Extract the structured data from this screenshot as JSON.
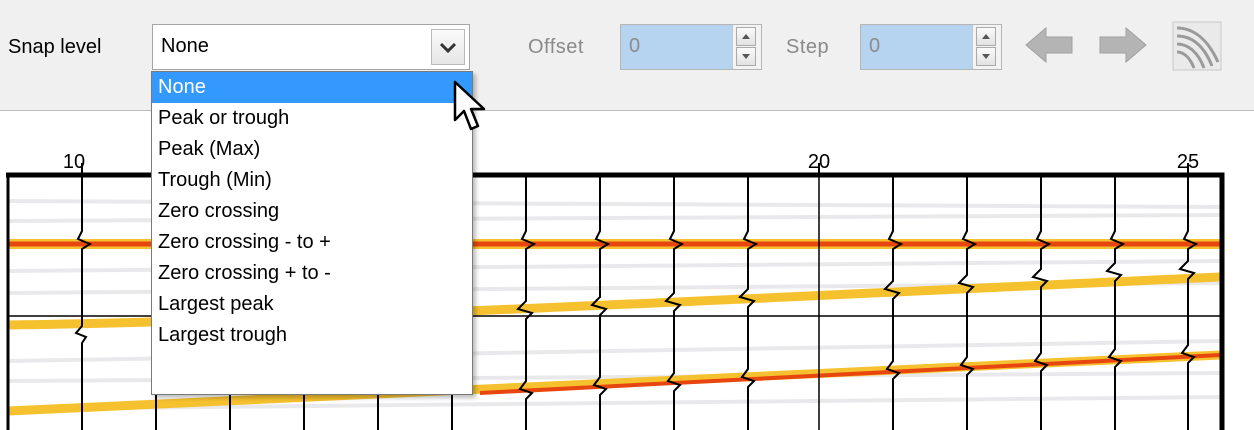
{
  "toolbar": {
    "snap_label": "Snap level",
    "snap_value": "None",
    "offset_label": "Offset",
    "offset_value": "0",
    "step_label": "Step",
    "step_value": "0"
  },
  "snap_menu": {
    "items": [
      "None",
      "Peak or trough",
      "Peak (Max)",
      "Trough (Min)",
      "Zero crossing",
      "Zero crossing - to +",
      "Zero crossing + to -",
      "Largest peak",
      "Largest trough"
    ],
    "selected_index": 0
  },
  "axis": {
    "tick_labels": [
      "10",
      "20",
      "25"
    ]
  },
  "icons": {
    "prev": "arrow-left-icon",
    "next": "arrow-right-icon",
    "wiggle": "wiggle-traces-icon",
    "dropdown": "chevron-down-icon",
    "spin_up": "spin-up-icon",
    "spin_down": "spin-down-icon",
    "cursor": "mouse-pointer-icon"
  },
  "colors": {
    "selection": "#3399ff",
    "spin_field": "#b6d3f0",
    "horizon_red": "#e8460f",
    "horizon_yellow": "#f6c12e"
  }
}
